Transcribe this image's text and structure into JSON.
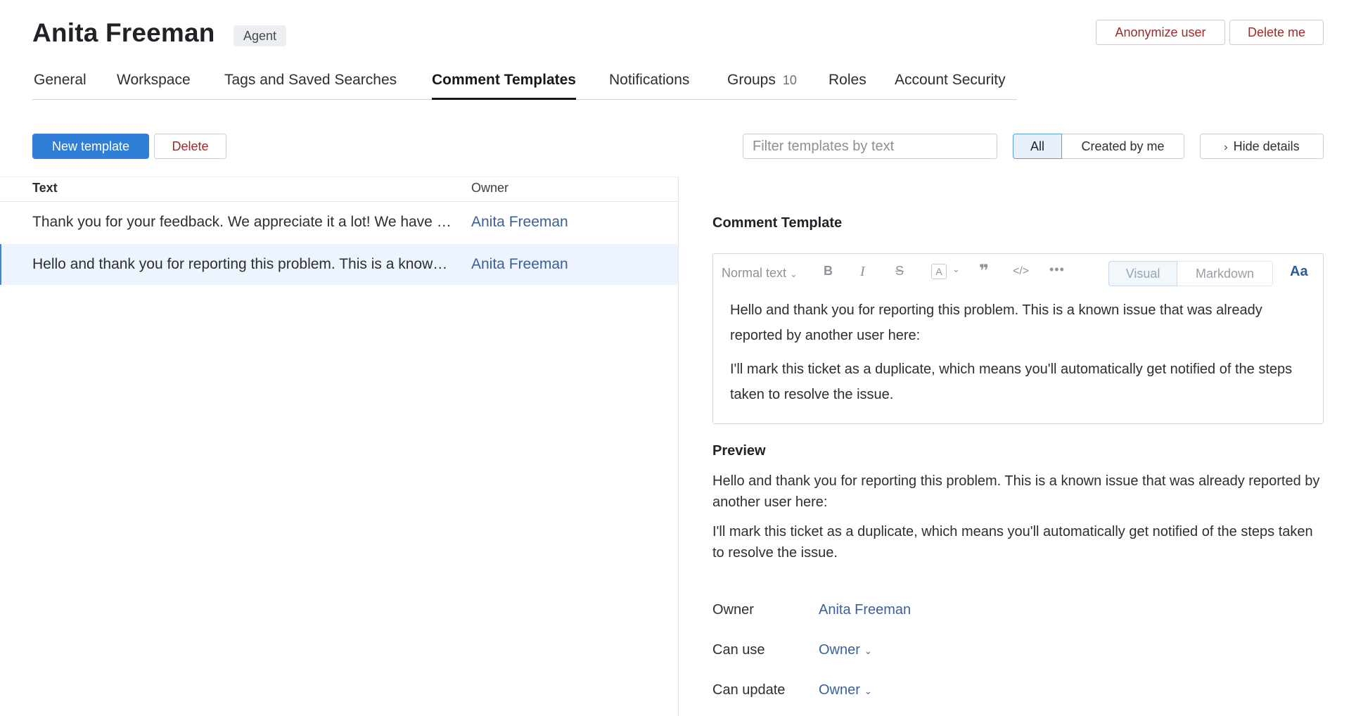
{
  "header": {
    "user_name": "Anita Freeman",
    "role_badge": "Agent",
    "anonymize_label": "Anonymize user",
    "delete_me_label": "Delete me"
  },
  "tabs": [
    {
      "label": "General"
    },
    {
      "label": "Workspace"
    },
    {
      "label": "Tags and Saved Searches"
    },
    {
      "label": "Comment Templates",
      "active": true
    },
    {
      "label": "Notifications"
    },
    {
      "label": "Groups",
      "count": "10"
    },
    {
      "label": "Roles"
    },
    {
      "label": "Account Security"
    }
  ],
  "toolbar": {
    "new_template_label": "New template",
    "delete_label": "Delete",
    "filter_placeholder": "Filter templates by text",
    "filter_all": "All",
    "filter_created_by_me": "Created by me",
    "hide_details_label": "Hide details"
  },
  "table": {
    "columns": [
      "Text",
      "Owner"
    ],
    "rows": [
      {
        "text": "Thank you for your feedback. We appreciate it a lot! We have forwarded it to the team.",
        "owner": "Anita Freeman"
      },
      {
        "text": "Hello and thank you for reporting this problem. This is a known issue that was already reported by another user here:",
        "owner": "Anita Freeman",
        "selected": true
      }
    ]
  },
  "detail": {
    "title": "Comment Template",
    "editor": {
      "block_style": "Normal text",
      "bold_icon": "B",
      "italic_icon": "I",
      "strike_icon": "S",
      "color_icon": "A",
      "quote_icon": "❞",
      "code_icon": "</>",
      "more_icon": "•••",
      "mode_visual": "Visual",
      "mode_markdown": "Markdown",
      "format_toggle": "Aa",
      "paragraphs": [
        "Hello and thank you for reporting this problem. This is a known issue that was already reported by another user here:",
        "I'll mark this ticket as a duplicate, which means you'll automatically get notified of the steps taken to resolve the issue."
      ]
    },
    "preview_title": "Preview",
    "preview_paragraphs": [
      "Hello and thank you for reporting this problem. This is a known issue that was already reported by another user here:",
      "I'll mark this ticket as a duplicate, which means you'll automatically get notified of the steps taken to resolve the issue."
    ],
    "meta": {
      "owner_label": "Owner",
      "owner_value": "Anita Freeman",
      "can_use_label": "Can use",
      "can_use_value": "Owner",
      "can_update_label": "Can update",
      "can_update_value": "Owner"
    }
  }
}
